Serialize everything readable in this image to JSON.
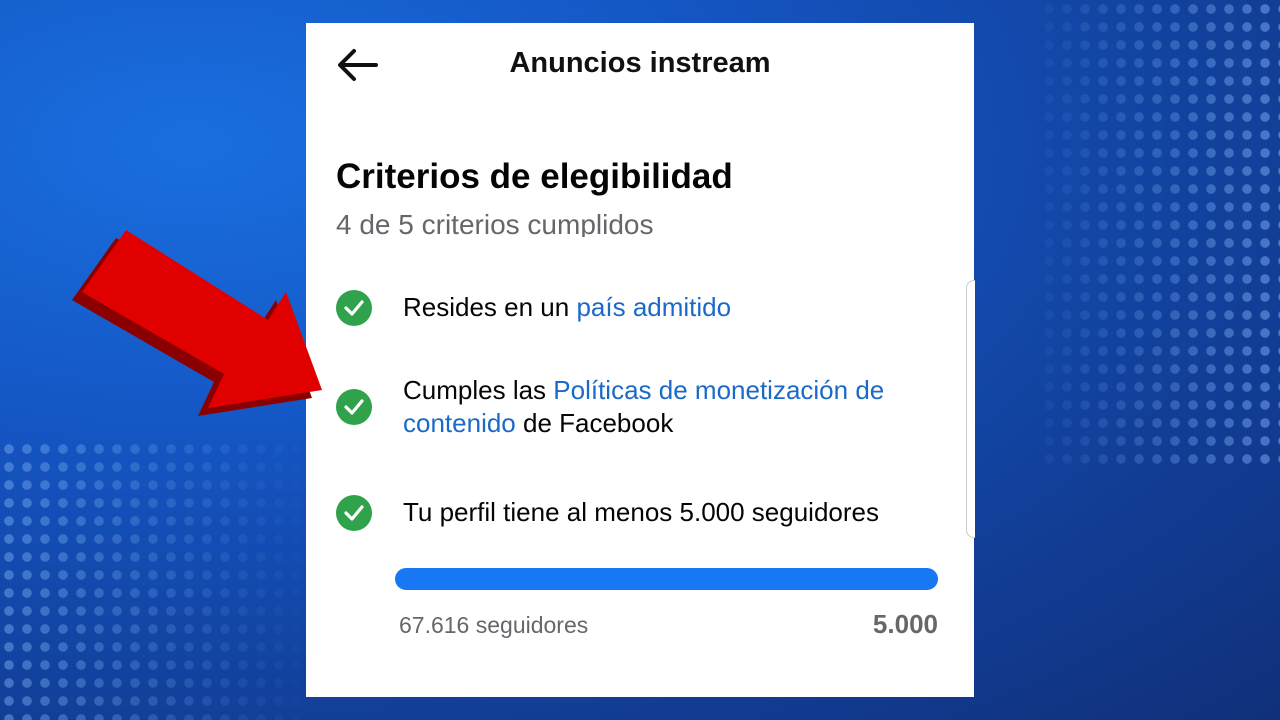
{
  "header": {
    "title": "Anuncios instream",
    "back_icon": "arrow-left-icon"
  },
  "eligibility": {
    "title": "Criterios de elegibilidad",
    "subtitle": "4 de 5 criterios cumplidos",
    "check_color": "#31a24c",
    "link_color": "#1b6ac9",
    "criteria": [
      {
        "prefix": "Resides en un ",
        "link": "país admitido",
        "suffix": ""
      },
      {
        "prefix": "Cumples las ",
        "link": "Políticas de monetización de contenido",
        "suffix": " de Facebook"
      },
      {
        "text": "Tu perfil tiene al menos 5.000 seguidores"
      }
    ]
  },
  "progress": {
    "fraction": 1.0,
    "color": "#1877f2",
    "current_label": "67.616 seguidores",
    "goal_label": "5.000"
  },
  "overlay": {
    "arrow_icon": "red-arrow-icon",
    "arrow_color": "#e00000"
  }
}
